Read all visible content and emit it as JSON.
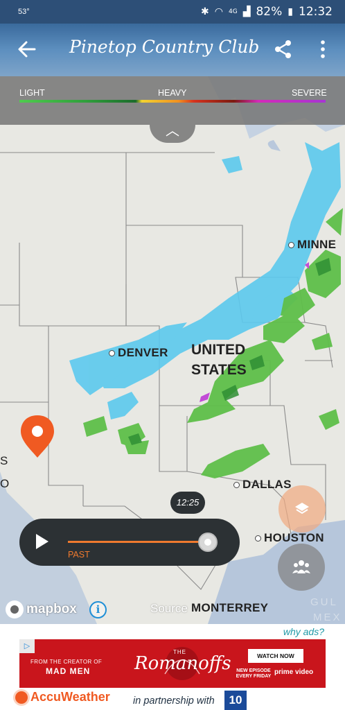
{
  "status_bar": {
    "temperature": "53°",
    "battery": "82%",
    "time": "12:32",
    "network": "4G"
  },
  "header": {
    "title": "Pinetop Country Club",
    "back_icon": "arrow-left-icon",
    "share_icon": "share-icon",
    "more_icon": "more-vertical-icon",
    "bg_color": "#3a6a9c"
  },
  "legend": {
    "light": "LIGHT",
    "heavy": "HEAVY",
    "severe": "SEVERE"
  },
  "map": {
    "cities": {
      "minneapolis": "MINNE",
      "denver": "DENVER",
      "dallas": "DALLAS",
      "houston": "HOUSTON",
      "monterrey": "MONTERREY"
    },
    "country": {
      "line1": "UNITED",
      "line2": "STATES"
    },
    "edge_labels": {
      "left_s": "S",
      "left_o": "O",
      "gulf": "GUL",
      "mex": "MEX"
    },
    "marker_color": "#f05a22"
  },
  "timeline": {
    "time": "12:25",
    "label": "PAST",
    "progress": 1.0,
    "accent": "#f07a2e"
  },
  "attribution": {
    "mapbox": "mapbox",
    "source": "Source"
  },
  "ad": {
    "why_ads": "why ads?",
    "creator_line": "FROM THE CREATOR OF",
    "mad_men": "MAD MEN",
    "the": "THE",
    "show": "Romanoffs",
    "watch_now": "WATCH NOW",
    "new_episode": "NEW EPISODE EVERY FRIDAY",
    "prime": "prime video",
    "banner_color": "#c9151c"
  },
  "footer": {
    "brand": "AccuWeather",
    "partnership": "in partnership with",
    "partner_logo": "10"
  }
}
